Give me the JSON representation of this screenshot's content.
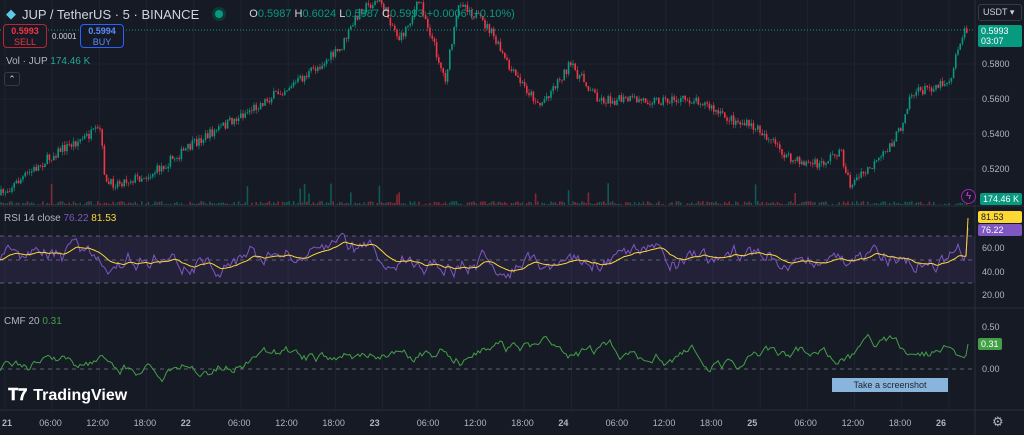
{
  "symbol": {
    "title": "JUP / TetherUS · 5 · BINANCE",
    "ohlc": {
      "o_label": "O",
      "o": "0.5987",
      "h_label": "H",
      "h": "0.6024",
      "l_label": "L",
      "l": "0.5987",
      "c_label": "C",
      "c": "0.5993",
      "change": "+0.0006 (+0.10%)"
    }
  },
  "trade": {
    "sell_price": "0.5993",
    "sell_label": "SELL",
    "spread": "0.0001",
    "buy_price": "0.5994",
    "buy_label": "BUY"
  },
  "volume": {
    "label": "Vol · JUP",
    "value": "174.46 K",
    "tag": "174.46 K"
  },
  "price_axis": {
    "currency": "USDT",
    "ticks": [
      "0.5800",
      "0.5600",
      "0.5400",
      "0.5200"
    ],
    "last_price": "0.5993",
    "countdown": "03:07"
  },
  "rsi": {
    "label": "RSI 14 close",
    "value": "76.22",
    "ma": "81.53",
    "ticks": [
      "60.00",
      "40.00",
      "20.00"
    ]
  },
  "cmf": {
    "label": "CMF 20",
    "value": "0.31",
    "ticks": [
      "0.50",
      "0.00"
    ]
  },
  "time_axis": [
    "21",
    "06:00",
    "12:00",
    "18:00",
    "22",
    "06:00",
    "12:00",
    "18:00",
    "23",
    "06:00",
    "12:00",
    "18:00",
    "24",
    "06:00",
    "12:00",
    "18:00",
    "25",
    "06:00",
    "12:00",
    "18:00",
    "26"
  ],
  "tooltip": "Take a screenshot",
  "brand": "TradingView",
  "colors": {
    "up": "#089981",
    "down": "#f23645",
    "rsi": "#7e57c2",
    "rsi_ma": "#fdd835",
    "cmf": "#43a047"
  }
}
